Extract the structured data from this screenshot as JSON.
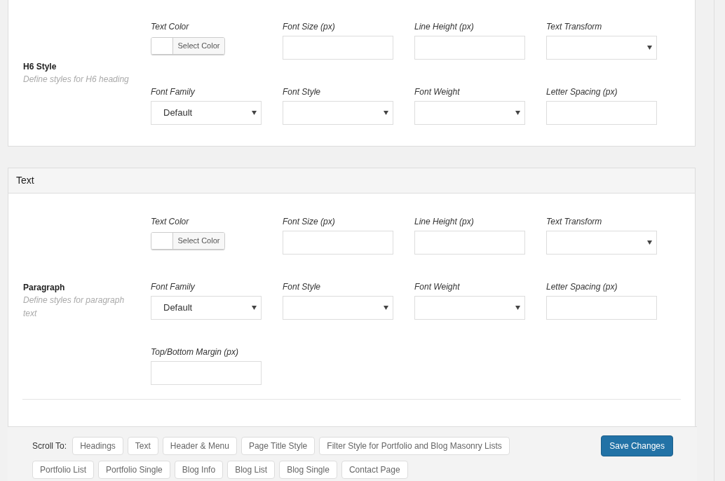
{
  "sections": [
    {
      "title": "H6 Style",
      "description": "Define styles for H6 heading",
      "fields": [
        {
          "label": "Text Color",
          "kind": "color",
          "button": "Select Color"
        },
        {
          "label": "Font Size (px)",
          "kind": "input"
        },
        {
          "label": "Line Height (px)",
          "kind": "input"
        },
        {
          "label": "Text Transform",
          "kind": "select"
        },
        {
          "label": "Font Family",
          "kind": "select",
          "value": "Default"
        },
        {
          "label": "Font Style",
          "kind": "select"
        },
        {
          "label": "Font Weight",
          "kind": "select"
        },
        {
          "label": "Letter Spacing (px)",
          "kind": "input"
        }
      ]
    },
    {
      "panel_title": "Text",
      "title": "Paragraph",
      "description": "Define styles for paragraph text",
      "fields": [
        {
          "label": "Text Color",
          "kind": "color",
          "button": "Select Color"
        },
        {
          "label": "Font Size (px)",
          "kind": "input"
        },
        {
          "label": "Line Height (px)",
          "kind": "input"
        },
        {
          "label": "Text Transform",
          "kind": "select"
        },
        {
          "label": "Font Family",
          "kind": "select",
          "value": "Default"
        },
        {
          "label": "Font Style",
          "kind": "select"
        },
        {
          "label": "Font Weight",
          "kind": "select"
        },
        {
          "label": "Letter Spacing (px)",
          "kind": "input"
        },
        {
          "label": "Top/Bottom Margin (px)",
          "kind": "input"
        }
      ]
    }
  ],
  "scroll_bar": {
    "label": "Scroll To:",
    "links": [
      [
        "Headings",
        "Text",
        "Header & Menu",
        "Page Title Style",
        "Filter Style for Portfolio and Blog Masonry Lists"
      ],
      [
        "Portfolio List",
        "Portfolio Single",
        "Blog Info",
        "Blog List",
        "Blog Single",
        "Contact Page"
      ]
    ],
    "save": "Save Changes"
  }
}
